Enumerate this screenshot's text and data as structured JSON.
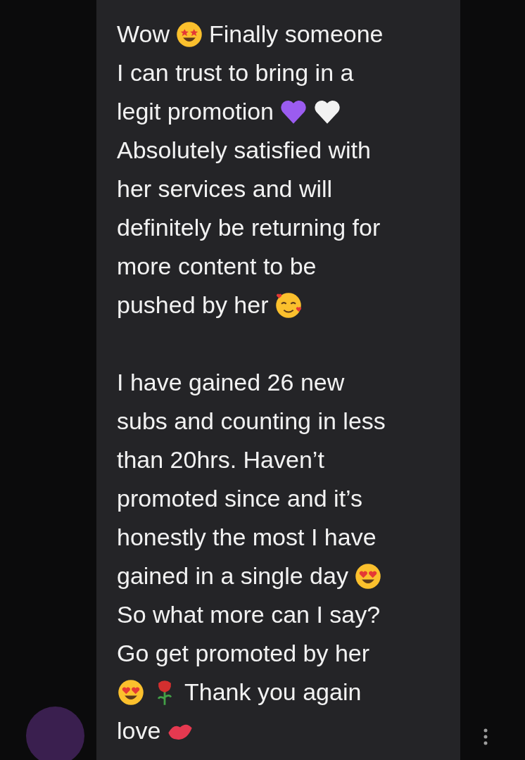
{
  "message": {
    "paragraphs": [
      {
        "lines": [
          [
            {
              "kind": "text",
              "text": "Wow"
            },
            {
              "kind": "star_eyes"
            },
            {
              "kind": "text",
              "text": "Finally someone"
            }
          ],
          [
            {
              "kind": "text",
              "text": "I can trust to bring in a"
            }
          ],
          [
            {
              "kind": "text",
              "text": "legit promotion"
            },
            {
              "kind": "heart",
              "color": "#9b5cf0"
            },
            {
              "kind": "heart",
              "color": "#f2f2f2"
            }
          ],
          [
            {
              "kind": "text",
              "text": "Absolutely satisfied with"
            }
          ],
          [
            {
              "kind": "text",
              "text": "her services and will"
            }
          ],
          [
            {
              "kind": "text",
              "text": "definitely be returning for"
            }
          ],
          [
            {
              "kind": "text",
              "text": "more content to be"
            }
          ],
          [
            {
              "kind": "text",
              "text": "pushed by her"
            },
            {
              "kind": "smile_hearts"
            }
          ]
        ]
      },
      {
        "lines": [
          [
            {
              "kind": "text",
              "text": "I have gained 26 new"
            }
          ],
          [
            {
              "kind": "text",
              "text": "subs and counting in less"
            }
          ],
          [
            {
              "kind": "text",
              "text": "than 20hrs. Haven’t"
            }
          ],
          [
            {
              "kind": "text",
              "text": "promoted since and it’s"
            }
          ],
          [
            {
              "kind": "text",
              "text": "honestly the most I have"
            }
          ],
          [
            {
              "kind": "text",
              "text": "gained in a single day"
            },
            {
              "kind": "heart_eyes"
            }
          ],
          [
            {
              "kind": "text",
              "text": "So what more can I say?"
            }
          ],
          [
            {
              "kind": "text",
              "text": "Go get promoted by her"
            }
          ],
          [
            {
              "kind": "heart_eyes"
            },
            {
              "kind": "rose"
            },
            {
              "kind": "text",
              "text": "Thank you again"
            }
          ],
          [
            {
              "kind": "text",
              "text": "love"
            },
            {
              "kind": "lips"
            }
          ]
        ]
      }
    ]
  }
}
